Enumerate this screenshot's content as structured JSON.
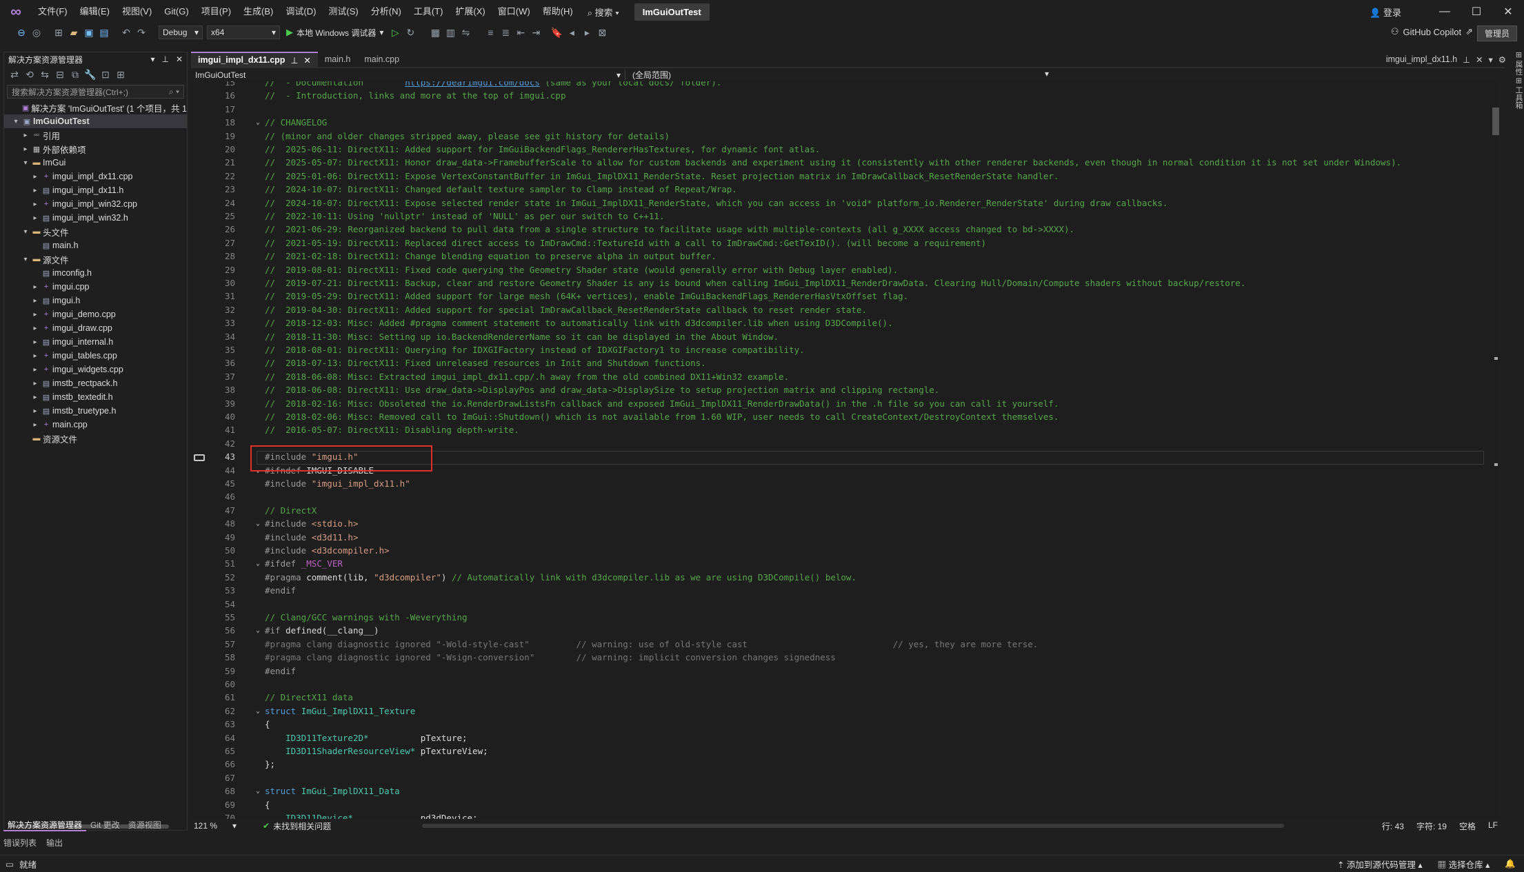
{
  "menubar": {
    "items": [
      "文件(F)",
      "编辑(E)",
      "视图(V)",
      "Git(G)",
      "项目(P)",
      "生成(B)",
      "调试(D)",
      "测试(S)",
      "分析(N)",
      "工具(T)",
      "扩展(X)",
      "窗口(W)",
      "帮助(H)"
    ],
    "search": "搜索",
    "solution_title": "ImGuiOutTest",
    "login": "登录"
  },
  "toolbar": {
    "config": "Debug",
    "platform": "x64",
    "run_label": "本地 Windows 调试器",
    "copilot": "GitHub Copilot",
    "admin": "管理员"
  },
  "solution_explorer": {
    "title": "解决方案资源管理器",
    "search_placeholder": "搜索解决方案资源管理器(Ctrl+;)",
    "tree": [
      {
        "label": "解决方案 'ImGuiOutTest' (1 个项目，共 1",
        "indent": 0,
        "arrow": "",
        "icon": "sln"
      },
      {
        "label": "ImGuiOutTest",
        "indent": 0,
        "arrow": "▾",
        "icon": "proj",
        "bold": true,
        "selected": true
      },
      {
        "label": "引用",
        "indent": 1,
        "arrow": "▸",
        "icon": "ref"
      },
      {
        "label": "外部依赖项",
        "indent": 1,
        "arrow": "▸",
        "icon": "ext"
      },
      {
        "label": "ImGui",
        "indent": 1,
        "arrow": "▾",
        "icon": "folder"
      },
      {
        "label": "imgui_impl_dx11.cpp",
        "indent": 2,
        "arrow": "▸",
        "icon": "cpp"
      },
      {
        "label": "imgui_impl_dx11.h",
        "indent": 2,
        "arrow": "▸",
        "icon": "h"
      },
      {
        "label": "imgui_impl_win32.cpp",
        "indent": 2,
        "arrow": "▸",
        "icon": "cpp"
      },
      {
        "label": "imgui_impl_win32.h",
        "indent": 2,
        "arrow": "▸",
        "icon": "h"
      },
      {
        "label": "头文件",
        "indent": 1,
        "arrow": "▾",
        "icon": "folder"
      },
      {
        "label": "main.h",
        "indent": 2,
        "arrow": "",
        "icon": "h"
      },
      {
        "label": "源文件",
        "indent": 1,
        "arrow": "▾",
        "icon": "folder"
      },
      {
        "label": "imconfig.h",
        "indent": 2,
        "arrow": "",
        "icon": "h"
      },
      {
        "label": "imgui.cpp",
        "indent": 2,
        "arrow": "▸",
        "icon": "cpp"
      },
      {
        "label": "imgui.h",
        "indent": 2,
        "arrow": "▸",
        "icon": "h"
      },
      {
        "label": "imgui_demo.cpp",
        "indent": 2,
        "arrow": "▸",
        "icon": "cpp"
      },
      {
        "label": "imgui_draw.cpp",
        "indent": 2,
        "arrow": "▸",
        "icon": "cpp"
      },
      {
        "label": "imgui_internal.h",
        "indent": 2,
        "arrow": "▸",
        "icon": "h"
      },
      {
        "label": "imgui_tables.cpp",
        "indent": 2,
        "arrow": "▸",
        "icon": "cpp"
      },
      {
        "label": "imgui_widgets.cpp",
        "indent": 2,
        "arrow": "▸",
        "icon": "cpp"
      },
      {
        "label": "imstb_rectpack.h",
        "indent": 2,
        "arrow": "▸",
        "icon": "h"
      },
      {
        "label": "imstb_textedit.h",
        "indent": 2,
        "arrow": "▸",
        "icon": "h"
      },
      {
        "label": "imstb_truetype.h",
        "indent": 2,
        "arrow": "▸",
        "icon": "h"
      },
      {
        "label": "main.cpp",
        "indent": 2,
        "arrow": "▸",
        "icon": "cpp"
      },
      {
        "label": "资源文件",
        "indent": 1,
        "arrow": "",
        "icon": "folder"
      }
    ],
    "bottom_tabs": [
      "解决方案资源管理器",
      "Git 更改",
      "资源视图"
    ]
  },
  "editor": {
    "tabs": [
      {
        "label": "imgui_impl_dx11.cpp",
        "active": true,
        "pinned": true
      },
      {
        "label": "main.h",
        "active": false
      },
      {
        "label": "main.cpp",
        "active": false
      }
    ],
    "right_tab": "imgui_impl_dx11.h",
    "nav_project": "ImGuiOutTest",
    "nav_scope": "(全局范围)",
    "first_line": 15,
    "current_line": 43,
    "lines": [
      [
        [
          "c",
          "//  - Documentation        "
        ],
        [
          "u",
          "https://dearimgui.com/docs"
        ],
        [
          "c",
          " (same as your local docs/ folder)."
        ]
      ],
      [
        [
          "c",
          "//  - Introduction, links and more at the top of imgui.cpp"
        ]
      ],
      [],
      [
        [
          "c",
          "// CHANGELOG"
        ]
      ],
      [
        [
          "c",
          "// (minor and older changes stripped away, please see git history for details)"
        ]
      ],
      [
        [
          "c",
          "//  2025-06-11: DirectX11: Added support for ImGuiBackendFlags_RendererHasTextures, for dynamic font atlas."
        ]
      ],
      [
        [
          "c",
          "//  2025-05-07: DirectX11: Honor draw_data->FramebufferScale to allow for custom backends and experiment using it (consistently with other renderer backends, even though in normal condition it is not set under Windows)."
        ]
      ],
      [
        [
          "c",
          "//  2025-01-06: DirectX11: Expose VertexConstantBuffer in ImGui_ImplDX11_RenderState. Reset projection matrix in ImDrawCallback_ResetRenderState handler."
        ]
      ],
      [
        [
          "c",
          "//  2024-10-07: DirectX11: Changed default texture sampler to Clamp instead of Repeat/Wrap."
        ]
      ],
      [
        [
          "c",
          "//  2024-10-07: DirectX11: Expose selected render state in ImGui_ImplDX11_RenderState, which you can access in 'void* platform_io.Renderer_RenderState' during draw callbacks."
        ]
      ],
      [
        [
          "c",
          "//  2022-10-11: Using 'nullptr' instead of 'NULL' as per our switch to C++11."
        ]
      ],
      [
        [
          "c",
          "//  2021-06-29: Reorganized backend to pull data from a single structure to facilitate usage with multiple-contexts (all g_XXXX access changed to bd->XXXX)."
        ]
      ],
      [
        [
          "c",
          "//  2021-05-19: DirectX11: Replaced direct access to ImDrawCmd::TextureId with a call to ImDrawCmd::GetTexID(). (will become a requirement)"
        ]
      ],
      [
        [
          "c",
          "//  2021-02-18: DirectX11: Change blending equation to preserve alpha in output buffer."
        ]
      ],
      [
        [
          "c",
          "//  2019-08-01: DirectX11: Fixed code querying the Geometry Shader state (would generally error with Debug layer enabled)."
        ]
      ],
      [
        [
          "c",
          "//  2019-07-21: DirectX11: Backup, clear and restore Geometry Shader is any is bound when calling ImGui_ImplDX11_RenderDrawData. Clearing Hull/Domain/Compute shaders without backup/restore."
        ]
      ],
      [
        [
          "c",
          "//  2019-05-29: DirectX11: Added support for large mesh (64K+ vertices), enable ImGuiBackendFlags_RendererHasVtxOffset flag."
        ]
      ],
      [
        [
          "c",
          "//  2019-04-30: DirectX11: Added support for special ImDrawCallback_ResetRenderState callback to reset render state."
        ]
      ],
      [
        [
          "c",
          "//  2018-12-03: Misc: Added #pragma comment statement to automatically link with d3dcompiler.lib when using D3DCompile()."
        ]
      ],
      [
        [
          "c",
          "//  2018-11-30: Misc: Setting up io.BackendRendererName so it can be displayed in the About Window."
        ]
      ],
      [
        [
          "c",
          "//  2018-08-01: DirectX11: Querying for IDXGIFactory instead of IDXGIFactory1 to increase compatibility."
        ]
      ],
      [
        [
          "c",
          "//  2018-07-13: DirectX11: Fixed unreleased resources in Init and Shutdown functions."
        ]
      ],
      [
        [
          "c",
          "//  2018-06-08: Misc: Extracted imgui_impl_dx11.cpp/.h away from the old combined DX11+Win32 example."
        ]
      ],
      [
        [
          "c",
          "//  2018-06-08: DirectX11: Use draw_data->DisplayPos and draw_data->DisplaySize to setup projection matrix and clipping rectangle."
        ]
      ],
      [
        [
          "c",
          "//  2018-02-16: Misc: Obsoleted the io.RenderDrawListsFn callback and exposed ImGui_ImplDX11_RenderDrawData() in the .h file so you can call it yourself."
        ]
      ],
      [
        [
          "c",
          "//  2018-02-06: Misc: Removed call to ImGui::Shutdown() which is not available from 1.60 WIP, user needs to call CreateContext/DestroyContext themselves."
        ]
      ],
      [
        [
          "c",
          "//  2016-05-07: DirectX11: Disabling depth-write."
        ]
      ],
      [],
      [
        [
          "p",
          "#include "
        ],
        [
          "s",
          "\"imgui.h\""
        ]
      ],
      [
        [
          "p",
          "#ifndef "
        ],
        [
          "w",
          "IMGUI_DISABLE"
        ]
      ],
      [
        [
          "p",
          "#include "
        ],
        [
          "s",
          "\"imgui_impl_dx11.h\""
        ]
      ],
      [],
      [
        [
          "c",
          "// DirectX"
        ]
      ],
      [
        [
          "p",
          "#include "
        ],
        [
          "s",
          "<stdio.h>"
        ]
      ],
      [
        [
          "p",
          "#include "
        ],
        [
          "s",
          "<d3d11.h>"
        ]
      ],
      [
        [
          "p",
          "#include "
        ],
        [
          "s",
          "<d3dcompiler.h>"
        ]
      ],
      [
        [
          "p",
          "#ifdef "
        ],
        [
          "m",
          "_MSC_VER"
        ]
      ],
      [
        [
          "p",
          "#pragma "
        ],
        [
          "w",
          "comment(lib, "
        ],
        [
          "s",
          "\"d3dcompiler\""
        ],
        [
          "w",
          ") "
        ],
        [
          "c",
          "// Automatically link with d3dcompiler.lib as we are using D3DCompile() below."
        ]
      ],
      [
        [
          "p",
          "#endif"
        ]
      ],
      [],
      [
        [
          "c",
          "// Clang/GCC warnings with -Weverything"
        ]
      ],
      [
        [
          "p",
          "#if "
        ],
        [
          "w",
          "defined(__clang__)"
        ]
      ],
      [
        [
          "g",
          "#pragma clang diagnostic ignored "
        ],
        [
          "g",
          "\"-Wold-style-cast\"         // warning: use of old-style cast                            // yes, they are more terse."
        ]
      ],
      [
        [
          "g",
          "#pragma clang diagnostic ignored "
        ],
        [
          "g",
          "\"-Wsign-conversion\"        // warning: implicit conversion changes signedness"
        ]
      ],
      [
        [
          "p",
          "#endif"
        ]
      ],
      [],
      [
        [
          "c",
          "// DirectX11 data"
        ]
      ],
      [
        [
          "k",
          "struct "
        ],
        [
          "t",
          "ImGui_ImplDX11_Texture"
        ]
      ],
      [
        [
          "w",
          "{"
        ]
      ],
      [
        [
          "w",
          "    "
        ],
        [
          "t",
          "ID3D11Texture2D*"
        ],
        [
          "w",
          "          pTexture;"
        ]
      ],
      [
        [
          "w",
          "    "
        ],
        [
          "t",
          "ID3D11ShaderResourceView*"
        ],
        [
          "w",
          " pTextureView;"
        ]
      ],
      [
        [
          "w",
          "};"
        ]
      ],
      [],
      [
        [
          "k",
          "struct "
        ],
        [
          "t",
          "ImGui_ImplDX11_Data"
        ]
      ],
      [
        [
          "w",
          "{"
        ]
      ],
      [
        [
          "w",
          "    "
        ],
        [
          "t",
          "ID3D11Device*"
        ],
        [
          "w",
          "             pd3dDevice;"
        ]
      ]
    ],
    "fold_lines": [
      18,
      44,
      48,
      51,
      56,
      62,
      68
    ]
  },
  "editor_status": {
    "zoom": "121 %",
    "issues": "未找到相关问题",
    "line": "行: 43",
    "char": "字符: 19",
    "space": "空格",
    "eol": "LF"
  },
  "bottom_tabs": [
    "错误列表",
    "输出"
  ],
  "statusbar": {
    "ready": "就绪",
    "add_source": "添加到源代码管理",
    "select_repo": "选择仓库"
  },
  "colors": {
    "accent": "#b180d7",
    "highlight_box": "#e0322b",
    "comment": "#57a64a",
    "keyword": "#569cd6"
  }
}
